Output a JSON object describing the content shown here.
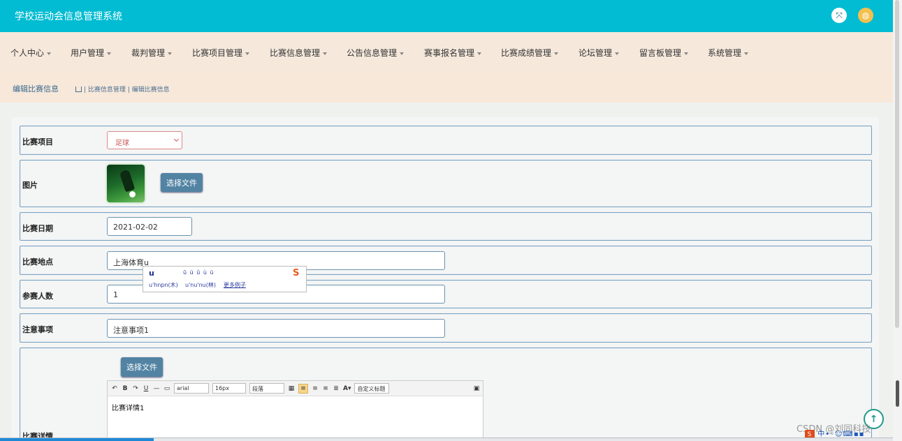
{
  "app": {
    "title": "学校运动会信息管理系统"
  },
  "header": {
    "fullscreen_icon": "fullscreen-icon",
    "user_icon": "user-avatar-icon"
  },
  "nav": {
    "items": [
      {
        "label": "个人中心"
      },
      {
        "label": "用户管理"
      },
      {
        "label": "裁判管理"
      },
      {
        "label": "比赛项目管理"
      },
      {
        "label": "比赛信息管理"
      },
      {
        "label": "公告信息管理"
      },
      {
        "label": "赛事报名管理"
      },
      {
        "label": "比赛成绩管理"
      },
      {
        "label": "论坛管理"
      },
      {
        "label": "留言板管理"
      },
      {
        "label": "系统管理"
      }
    ]
  },
  "breadcrumb": {
    "page_name": "编辑比赛信息",
    "path": "| 比赛信息管理 | 编辑比赛信息"
  },
  "form": {
    "project": {
      "label": "比赛项目",
      "selected": "足球"
    },
    "image": {
      "label": "图片",
      "button": "选择文件"
    },
    "date": {
      "label": "比赛日期",
      "value": "2021-02-02"
    },
    "location": {
      "label": "比赛地点",
      "value": "上海体育u"
    },
    "participants": {
      "label": "参赛人数",
      "value": "1"
    },
    "notes": {
      "label": "注意事项",
      "value": "注意事项1"
    },
    "details": {
      "label": "比赛详情",
      "button": "选择文件",
      "toolbar": {
        "font": "arial",
        "size": "16px",
        "paragraph": "段落",
        "custom_title": "自定义标题"
      },
      "content": "比赛详情1"
    }
  },
  "ime": {
    "typed": "u",
    "tones": "ū ú ǔ ù ü",
    "candidate_1": "u'hnpn(木)",
    "candidate_2": "u'nu'nu(林)",
    "more": "更多例子"
  },
  "watermark": "CSDN @刘同科技"
}
